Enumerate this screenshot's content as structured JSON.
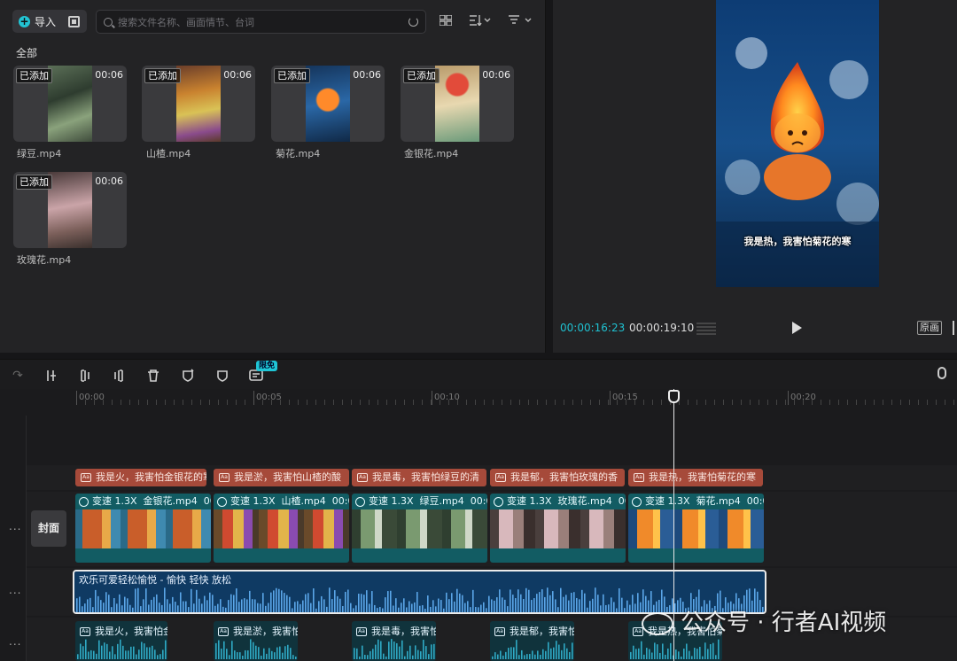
{
  "media": {
    "import_label": "导入",
    "search_placeholder": "搜索文件名称、画面情节、台词",
    "section_title": "全部",
    "items": [
      {
        "added": "已添加",
        "duration": "00:06",
        "name": "绿豆.mp4"
      },
      {
        "added": "已添加",
        "duration": "00:06",
        "name": "山楂.mp4"
      },
      {
        "added": "已添加",
        "duration": "00:06",
        "name": "菊花.mp4"
      },
      {
        "added": "已添加",
        "duration": "00:06",
        "name": "金银花.mp4"
      },
      {
        "added": "已添加",
        "duration": "00:06",
        "name": "玫瑰花.mp4"
      }
    ]
  },
  "preview": {
    "subtitle": "我是热，我害怕菊花的寒",
    "current_time": "00:00:16:23",
    "total_time": "00:00:19:10",
    "original_label": "原画"
  },
  "toolbar": {
    "free_badge": "限免"
  },
  "timeline": {
    "ruler": [
      "00:00",
      "00:05",
      "00:10",
      "00:15",
      "00:20"
    ],
    "cover_label": "封面",
    "subtitles": [
      "我是火，我害怕金银花的寒",
      "我是淤，我害怕山楂的酸",
      "我是毒，我害怕绿豆的清",
      "我是郁，我害怕玫瑰的香",
      "我是热，我害怕菊花的寒"
    ],
    "video_clips": [
      {
        "speed": "变速 1.3X",
        "name": "金银花.mp4",
        "time": "00:0"
      },
      {
        "speed": "变速 1.3X",
        "name": "山楂.mp4",
        "time": "00:0"
      },
      {
        "speed": "变速 1.3X",
        "name": "绿豆.mp4",
        "time": "00:0"
      },
      {
        "speed": "变速 1.3X",
        "name": "玫瑰花.mp4",
        "time": "00:0"
      },
      {
        "speed": "变速 1.3X",
        "name": "菊花.mp4",
        "time": "00:0"
      }
    ],
    "music_label": "欢乐可爱轻松愉悦 - 愉快 轻快 放松",
    "voice_clips": [
      "我是火，我害怕金",
      "我是淤，我害怕",
      "我是毒，我害怕",
      "我是郁，我害怕",
      "我是热，我害怕菊"
    ],
    "track_menu": "..."
  },
  "watermark": "公众号 · 行者AI视频"
}
